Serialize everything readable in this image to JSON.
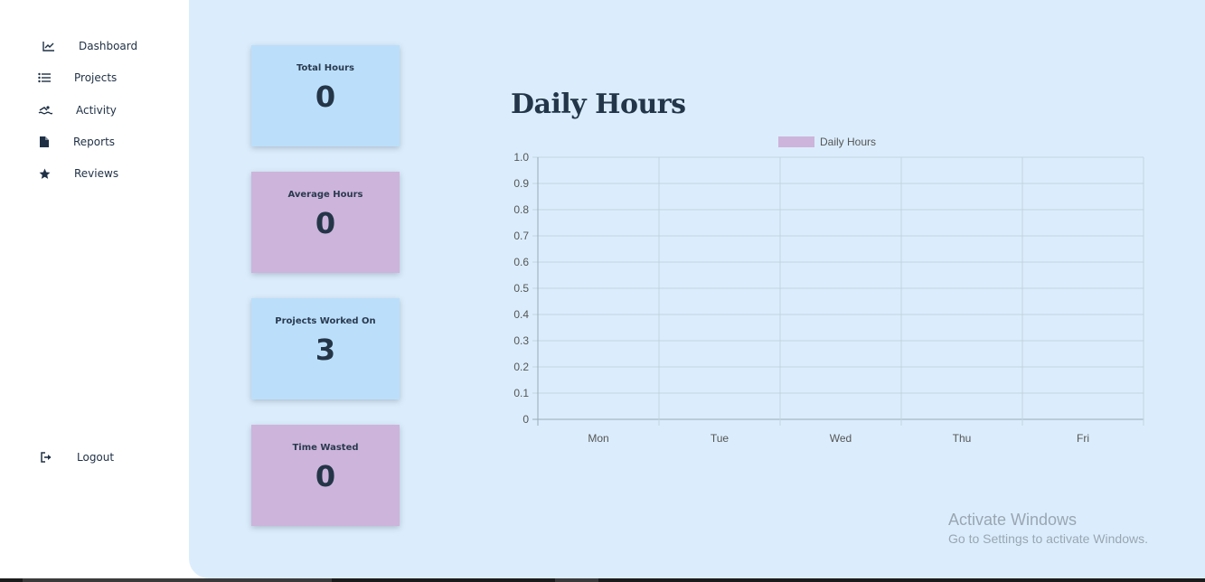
{
  "sidebar": {
    "items": [
      {
        "label": "Dashboard",
        "icon": "chart-line-icon"
      },
      {
        "label": "Projects",
        "icon": "list-icon"
      },
      {
        "label": "Activity",
        "icon": "swimmer-icon"
      },
      {
        "label": "Reports",
        "icon": "file-icon"
      },
      {
        "label": "Reviews",
        "icon": "star-icon"
      }
    ],
    "logout": {
      "label": "Logout",
      "icon": "sign-out-icon"
    }
  },
  "stats": [
    {
      "title": "Total Hours",
      "value": "0",
      "color": "#bbdffa"
    },
    {
      "title": "Average Hours",
      "value": "0",
      "color": "#cdb4da"
    },
    {
      "title": "Projects Worked On",
      "value": "3",
      "color": "#bbdffa"
    },
    {
      "title": "Time Wasted",
      "value": "0",
      "color": "#cdb4da"
    }
  ],
  "chart_data": {
    "type": "bar",
    "title": "Daily Hours",
    "categories": [
      "Mon",
      "Tue",
      "Wed",
      "Thu",
      "Fri"
    ],
    "series": [
      {
        "name": "Daily Hours",
        "values": [
          0,
          0,
          0,
          0,
          0
        ],
        "color": "#cdb4da"
      }
    ],
    "ylim": [
      0,
      1.0
    ],
    "yticks": [
      "0",
      "0.1",
      "0.2",
      "0.3",
      "0.4",
      "0.5",
      "0.6",
      "0.7",
      "0.8",
      "0.9",
      "1.0"
    ],
    "grid": true,
    "legend_position": "top"
  },
  "watermark": {
    "title": "Activate Windows",
    "subtitle": "Go to Settings to activate Windows."
  }
}
